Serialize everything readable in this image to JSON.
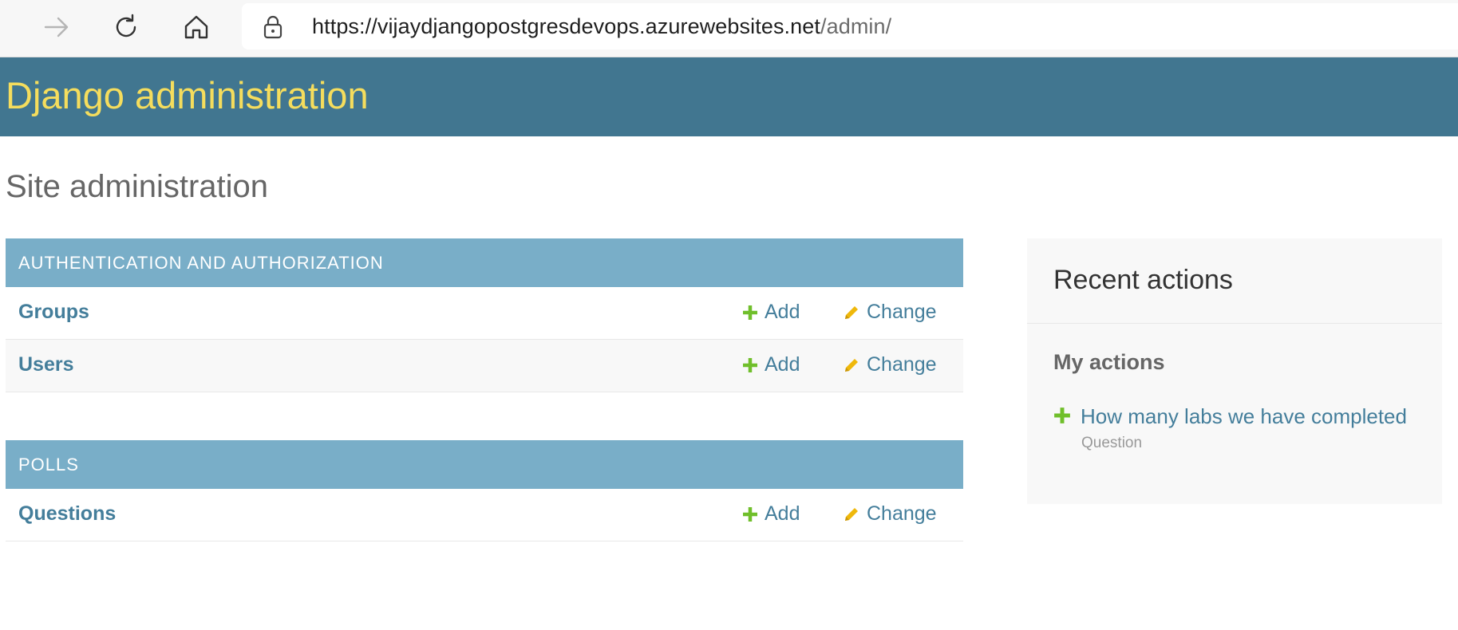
{
  "browser": {
    "url_host": "https://vijaydjangopostgresdevops.azurewebsites.net",
    "url_path": "/admin/"
  },
  "header": {
    "branding": "Django administration"
  },
  "page": {
    "title": "Site administration"
  },
  "modules": [
    {
      "caption": "AUTHENTICATION AND AUTHORIZATION",
      "rows": [
        {
          "name": "Groups",
          "add": "Add",
          "change": "Change"
        },
        {
          "name": "Users",
          "add": "Add",
          "change": "Change"
        }
      ]
    },
    {
      "caption": "POLLS",
      "rows": [
        {
          "name": "Questions",
          "add": "Add",
          "change": "Change"
        }
      ]
    }
  ],
  "recent_actions": {
    "title": "Recent actions",
    "subtitle": "My actions",
    "items": [
      {
        "label": "How many labs we have completed",
        "type": "Question",
        "icon": "plus-icon"
      }
    ]
  },
  "colors": {
    "header_bg": "#417690",
    "branding": "#f5dd5d",
    "caption_bg": "#79aec8",
    "link": "#447e9b",
    "add_icon": "#70bf2b",
    "change_icon": "#efb80b"
  }
}
